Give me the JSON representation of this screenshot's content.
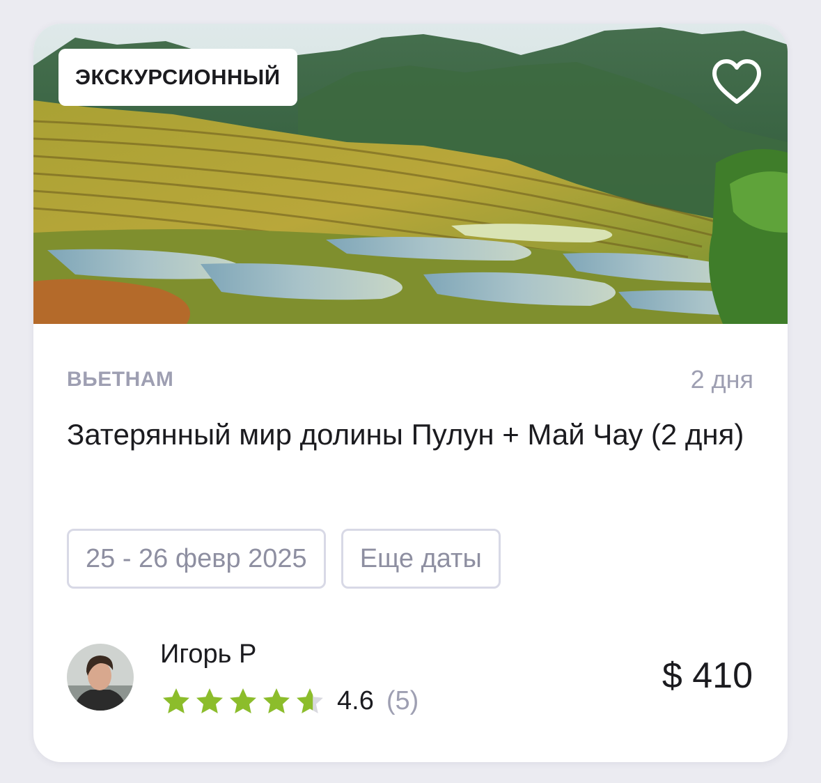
{
  "tour": {
    "category": "ЭКСКУРСИОННЫЙ",
    "country": "ВЬЕТНАМ",
    "duration": "2 дня",
    "title": "Затерянный мир долины Пулун + Май Чау (2 дня)",
    "date_range": "25 - 26 февр 2025",
    "more_dates": "Еще даты",
    "price": "$ 410"
  },
  "guide": {
    "name": "Игорь Р",
    "rating": "4.6",
    "reviews": "(5)",
    "stars": 4.6,
    "star_color": "#8cbd2b"
  },
  "icons": {
    "favorite": "heart-outline-icon",
    "star": "star-icon"
  }
}
